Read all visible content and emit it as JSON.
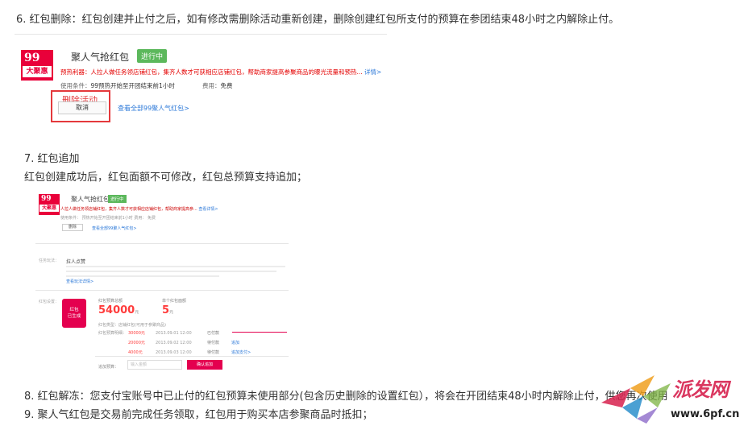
{
  "paragraphs": {
    "p6": "6.  红包删除：红包创建并止付之后，如有修改需删除活动重新创建，删除创建红包所支付的预算在参团结束48小时之内解除止付。",
    "p7_title": "7. 红包追加",
    "p7_body": "红包创建成功后，红包面额不可修改，红包总预算支持追加；",
    "p8": "8.  红包解冻：您支付宝账号中已止付的红包预算未使用部分(包含历史删除的设置红包），将会在开团结束48小时内解除止付，供您再次使用",
    "p9": "9. 聚人气红包是交易前完成任务领取，红包用于购买本店参聚商品时抵扣；"
  },
  "card1": {
    "logo_number": "99",
    "logo_text": "大聚惠",
    "title": "聚人气抢红包",
    "status_badge": "进行中",
    "warning": "预热利器：人拉人做任务领店铺红包，集齐人数才可获相应店铺红包，帮助商家提高参聚商品的曝光流量和预热...",
    "warning_link": "详情>",
    "condition_label": "使用条件：",
    "condition_value": "99预热开始至开团结束前1小时",
    "fee_label": "费用：",
    "fee_value": "免费",
    "delete_annotation": "删除活动",
    "cancel_button": "取消",
    "view_all_link": "查看全部99聚人气红包>"
  },
  "card2": {
    "logo_number": "99",
    "logo_text": "大聚惠",
    "title": "聚人气抢红包",
    "status_badge": "进行中",
    "warning": "人拉人做任务领店铺红包，集齐人数才可获相应店铺红包，帮助商家提高参...",
    "warning_link": "查看详情>",
    "condition": "使用条件：  预热开始至开团结束前1小时        费用：  免费",
    "cancel_button": "删除",
    "view_all_link": "查看全部99聚人气红包>",
    "sec1_label": "任务玩法：",
    "sec1_title": "拉人点赞",
    "sec1_more": "查看玩法详情>",
    "sec2_label": "红包设置：",
    "red_icon_line1": "红包",
    "red_icon_line2": "已生成",
    "budget_label": "红包预算总额",
    "budget_value": "54000",
    "budget_unit": "元",
    "amount_label": "单个红包面额",
    "amount_value": "5",
    "amount_unit": "元",
    "category": "红包类型：店铺红包(可用于参聚商品)",
    "records_label": "红包预算明细：",
    "records": [
      {
        "amount": "30000元",
        "time": "2013.09.01 12:00",
        "status": "已付款",
        "link": ""
      },
      {
        "amount": "20000元",
        "time": "2013.09.02 12:00",
        "status": "待付款",
        "link": "追加"
      },
      {
        "amount": "4000元",
        "time": "2013.09.03 12:00",
        "status": "待付款",
        "link": "追加支付>"
      }
    ],
    "add_label": "追加预算：",
    "add_placeholder": "输入金额",
    "add_button": "确认追加"
  },
  "watermark": {
    "cn": "派发网",
    "url": "www.6pf.cn"
  },
  "colors": {
    "accent_red": "#e4393c",
    "brand_pink": "#e4004f",
    "badge_green": "#5cb85c",
    "link_blue": "#2b78d8"
  }
}
